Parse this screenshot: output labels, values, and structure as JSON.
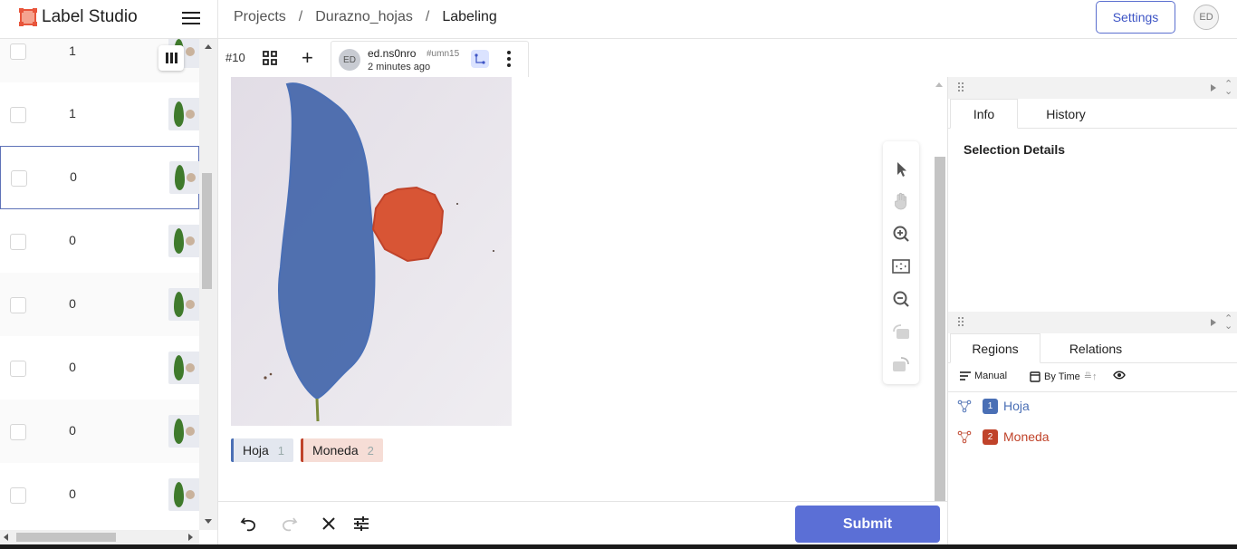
{
  "header": {
    "app_title": "Label Studio",
    "breadcrumb": [
      "Projects",
      "Durazno_hojas",
      "Labeling"
    ],
    "settings_label": "Settings",
    "user_initials": "ED"
  },
  "task_list": {
    "rows": [
      {
        "count": "1"
      },
      {
        "count": "1"
      },
      {
        "count": "0"
      },
      {
        "count": "0"
      },
      {
        "count": "0"
      },
      {
        "count": "0"
      },
      {
        "count": "0"
      },
      {
        "count": "0"
      }
    ]
  },
  "annotation_bar": {
    "task_id": "#10",
    "annotator_initials": "ED",
    "annotator_name": "ed.ns0nro",
    "annotation_hash": "#umn15",
    "time_ago": "2 minutes ago"
  },
  "labels": [
    {
      "name": "Hoja",
      "hotkey": "1",
      "color": "#4a6fb5",
      "bg": "#e3e7ef"
    },
    {
      "name": "Moneda",
      "hotkey": "2",
      "color": "#c0432a",
      "bg": "#f6ddd6"
    }
  ],
  "bottom_bar": {
    "submit_label": "Submit"
  },
  "info_panel": {
    "tabs": [
      "Info",
      "History"
    ],
    "active_tab": "Info",
    "selection_details": "Selection Details"
  },
  "regions_panel": {
    "tabs": [
      "Regions",
      "Relations"
    ],
    "active_tab": "Regions",
    "manual_label": "Manual",
    "sort_label": "By Time",
    "regions": [
      {
        "num": "1",
        "label": "Hoja",
        "color": "#4a6fb5"
      },
      {
        "num": "2",
        "label": "Moneda",
        "color": "#c0432a"
      }
    ]
  },
  "icons": {
    "logo": "label-studio-logo",
    "menu": "hamburger-icon",
    "grid": "grid-icon",
    "add": "plus-icon",
    "more": "kebab-icon",
    "undo": "undo-icon",
    "redo": "redo-icon",
    "reset": "close-icon",
    "settings": "sliders-icon"
  }
}
